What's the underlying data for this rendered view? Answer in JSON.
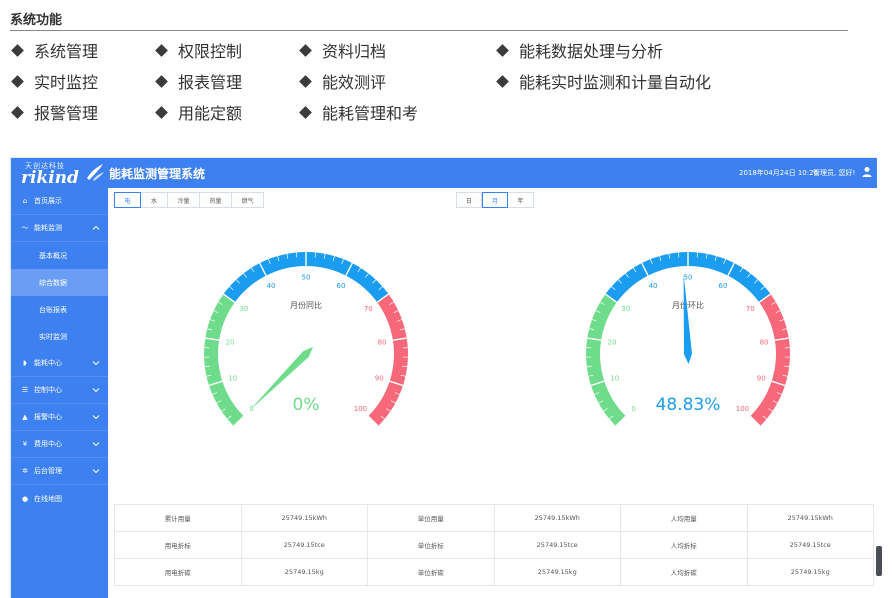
{
  "section": {
    "title": "系统功能",
    "features": [
      [
        "系统管理",
        "权限控制",
        "资料归档",
        "能耗数据处理与分析"
      ],
      [
        "实时监控",
        "报表管理",
        "能效测评",
        "能耗实时监测和计量自动化"
      ],
      [
        "报警管理",
        "用能定额",
        "能耗管理和考"
      ]
    ]
  },
  "app": {
    "logo_cn": "天创达科技",
    "logo_en": "rikind",
    "title": "能耗监测管理系统",
    "datetime": "2018年04月24日 10:26",
    "user_greeting": "管理员, 您好!",
    "colors": {
      "primary": "#3d80ef",
      "green": "#6fdc8c",
      "blue": "#1a9cf0",
      "red": "#f7687a"
    }
  },
  "sidebar": {
    "items": [
      {
        "icon": "home-icon",
        "glyph": "⌂",
        "label": "首页展示"
      },
      {
        "icon": "trend-icon",
        "glyph": "〜",
        "label": "能耗监测",
        "expanded": true
      },
      {
        "icon": "leaf-icon",
        "glyph": "◗",
        "label": "能耗中心"
      },
      {
        "icon": "control-icon",
        "glyph": "☰",
        "label": "控制中心"
      },
      {
        "icon": "warning-icon",
        "glyph": "▲",
        "label": "报警中心"
      },
      {
        "icon": "yen-icon",
        "glyph": "¥",
        "label": "费用中心"
      },
      {
        "icon": "gear-icon",
        "glyph": "✲",
        "label": "后台管理"
      },
      {
        "icon": "map-pin-icon",
        "glyph": "●",
        "label": "在线地图"
      }
    ],
    "subitems": [
      "基本概况",
      "综合数据",
      "台账报表",
      "实时监测"
    ],
    "active_sub": "综合数据"
  },
  "main": {
    "energy_tabs": [
      "电",
      "水",
      "冷量",
      "热量",
      "燃气"
    ],
    "active_energy_tab": "电",
    "period_tabs": [
      "日",
      "月",
      "年"
    ],
    "active_period_tab": "月",
    "gauges": [
      {
        "title": "月份同比",
        "value": 0,
        "display": "0%",
        "needle_color": "#6fdc8c",
        "value_color": "#6fdc8c"
      },
      {
        "title": "月份环比",
        "value": 48.83,
        "display": "48.83%",
        "needle_color": "#1a9cf0",
        "value_color": "#1a9cf0"
      }
    ],
    "gauge_scale": {
      "min": 0,
      "max": 100,
      "ticks": [
        "0",
        "10",
        "20",
        "30",
        "40",
        "50",
        "60",
        "70",
        "80",
        "90",
        "100"
      ]
    },
    "stats_rows": [
      [
        "累计用量",
        "25749.15kWh",
        "单位用量",
        "25749.15kWh",
        "人均用量",
        "25749.15kWh"
      ],
      [
        "用电折标",
        "25749.15tce",
        "单位折标",
        "25749.15tce",
        "人均折标",
        "25749.15tce"
      ],
      [
        "用电折碳",
        "25749.15kg",
        "单位折碳",
        "25749.15kg",
        "人均折碳",
        "25749.15kg"
      ]
    ]
  }
}
